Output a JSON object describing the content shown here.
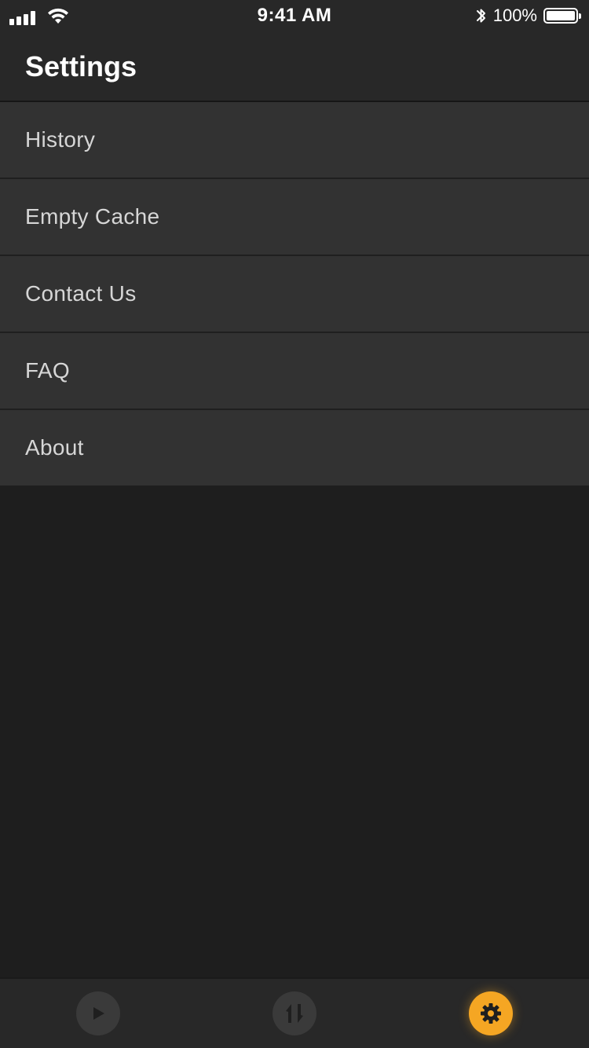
{
  "status_bar": {
    "time": "9:41 AM",
    "battery_percent": "100%",
    "battery_level": 1.0,
    "icons": [
      "signal-icon",
      "wifi-icon",
      "bluetooth-icon",
      "battery-icon"
    ]
  },
  "header": {
    "title": "Settings"
  },
  "menu": {
    "items": [
      {
        "label": "History"
      },
      {
        "label": "Empty Cache"
      },
      {
        "label": "Contact Us"
      },
      {
        "label": "FAQ"
      },
      {
        "label": "About"
      }
    ]
  },
  "tab_bar": {
    "tabs": [
      {
        "icon": "play-icon",
        "active": false
      },
      {
        "icon": "transfer-icon",
        "active": false
      },
      {
        "icon": "gear-icon",
        "active": true
      }
    ]
  },
  "colors": {
    "accent": "#f5a623",
    "background": "#1e1e1e",
    "surface": "#323232",
    "header": "#282828"
  }
}
